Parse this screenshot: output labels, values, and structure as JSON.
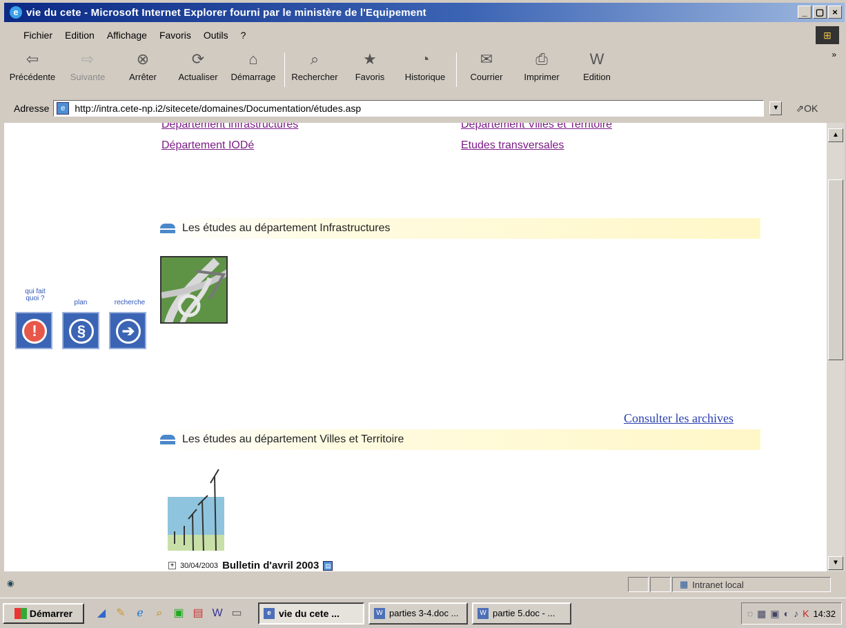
{
  "window": {
    "title": "vie du cete - Microsoft Internet Explorer fourni par le ministère de l'Equipement",
    "controls": [
      "_",
      "▢",
      "×"
    ]
  },
  "menu": [
    "Fichier",
    "Edition",
    "Affichage",
    "Favoris",
    "Outils",
    "?"
  ],
  "toolbar": {
    "buttons": [
      {
        "label": "Précédente",
        "icon": "back-arrow-icon",
        "glyph": "⇦"
      },
      {
        "label": "Suivante",
        "icon": "forward-arrow-icon",
        "glyph": "⇨"
      },
      {
        "label": "Arrêter",
        "icon": "stop-icon",
        "glyph": "⊗"
      },
      {
        "label": "Actualiser",
        "icon": "refresh-icon",
        "glyph": "⟳"
      },
      {
        "label": "Démarrage",
        "icon": "home-icon",
        "glyph": "⌂"
      },
      {
        "label": "Rechercher",
        "icon": "search-icon",
        "glyph": "⌕"
      },
      {
        "label": "Favoris",
        "icon": "favorites-icon",
        "glyph": "★"
      },
      {
        "label": "Historique",
        "icon": "history-icon",
        "glyph": "◔"
      },
      {
        "label": "Courrier",
        "icon": "mail-icon",
        "glyph": "✉"
      },
      {
        "label": "Imprimer",
        "icon": "print-icon",
        "glyph": "⎙"
      },
      {
        "label": "Edition",
        "icon": "edit-icon",
        "glyph": "W"
      }
    ],
    "more": "»"
  },
  "address": {
    "label": "Adresse",
    "url": "http://intra.cete-np.i2/sitecete/domaines/Documentation/études.asp",
    "go": "OK"
  },
  "content": {
    "links_top": [
      "Département infrastructures",
      "Département Villes et Territoire",
      "Département IODé",
      "Etudes transversales"
    ],
    "sections": [
      {
        "title": "Les études au département Infrastructures"
      },
      {
        "title": "Les études au département Villes et Territoire"
      }
    ],
    "archives_link": "Consulter les archives",
    "bulletin": {
      "date": "30/04/2003",
      "title": "Bulletin d'avril 2003"
    },
    "side_buttons": [
      {
        "label": "qui fait quoi ?",
        "glyph": "!",
        "color": "#e8584a"
      },
      {
        "label": "plan",
        "glyph": "§",
        "color": "#3b64b4"
      },
      {
        "label": "recherche",
        "glyph": "➔",
        "color": "#3b64b4"
      }
    ]
  },
  "status": {
    "zone": "Intranet local"
  },
  "taskbar": {
    "start": "Démarrer",
    "tasks": [
      {
        "label": "vie du cete ...",
        "active": true
      },
      {
        "label": "parties 3-4.doc ...",
        "active": false
      },
      {
        "label": "partie 5.doc - ...",
        "active": false
      }
    ],
    "time": "14:32"
  },
  "colors": {
    "link_visited": "#7b1c86",
    "link": "#2a3fb0",
    "section_bg": "#fff7c8",
    "title_bar": "#0b2a86"
  }
}
